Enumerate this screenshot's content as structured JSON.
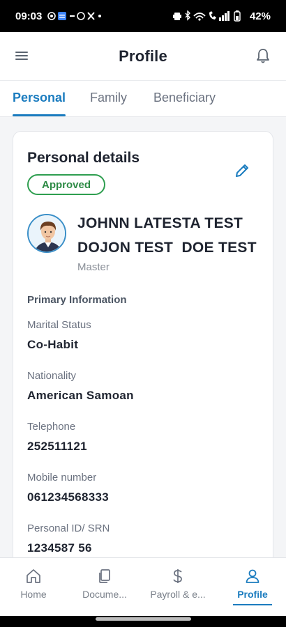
{
  "status_bar": {
    "time": "09:03",
    "battery": "42%"
  },
  "header": {
    "title": "Profile"
  },
  "tabs": [
    {
      "label": "Personal",
      "active": true
    },
    {
      "label": "Family",
      "active": false
    },
    {
      "label": "Beneficiary",
      "active": false
    }
  ],
  "card": {
    "title": "Personal details",
    "status_badge": "Approved",
    "name_line1": "JOHNN LATESTA TEST",
    "name_line2": "DOJON TEST  DOE TEST",
    "role": "Master",
    "section_title": "Primary Information",
    "fields": [
      {
        "label": "Marital Status",
        "value": "Co-Habit"
      },
      {
        "label": "Nationality",
        "value": "American Samoan"
      },
      {
        "label": "Telephone",
        "value": "252511121"
      },
      {
        "label": "Mobile number",
        "value": "061234568333"
      },
      {
        "label": "Personal ID/ SRN",
        "value": "1234587 56"
      }
    ]
  },
  "bottom_nav": [
    {
      "label": "Home",
      "icon": "home-icon",
      "active": false
    },
    {
      "label": "Docume...",
      "icon": "documents-icon",
      "active": false
    },
    {
      "label": "Payroll & e...",
      "icon": "dollar-icon",
      "active": false
    },
    {
      "label": "Profile",
      "icon": "person-icon",
      "active": true
    }
  ],
  "colors": {
    "accent": "#1b7cbf",
    "approved": "#2e9e4f",
    "text_primary": "#1f2430",
    "text_secondary": "#6b7280"
  }
}
